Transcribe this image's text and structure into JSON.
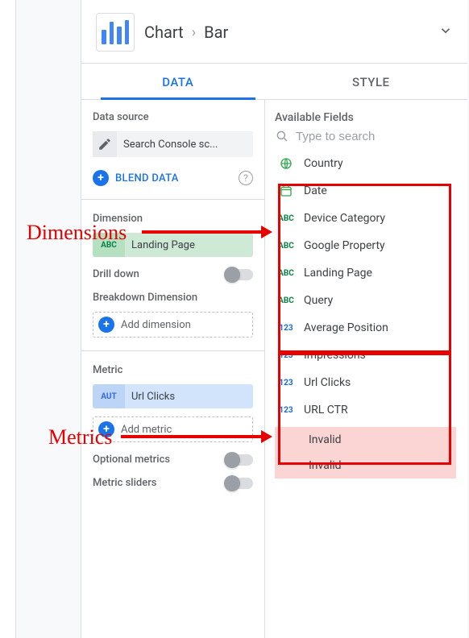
{
  "header": {
    "crumb_chart": "Chart",
    "crumb_type": "Bar"
  },
  "tabs": {
    "data": "DATA",
    "style": "STYLE"
  },
  "left": {
    "data_source_label": "Data source",
    "data_source_name": "Search Console sc...",
    "blend_label": "BLEND DATA",
    "dimension_label": "Dimension",
    "dimension_chip_tag": "ABC",
    "dimension_chip_text": "Landing Page",
    "drilldown_label": "Drill down",
    "breakdown_label": "Breakdown Dimension",
    "add_dimension": "Add dimension",
    "metric_label": "Metric",
    "metric_chip_tag": "AUT",
    "metric_chip_text": "Url Clicks",
    "add_metric": "Add metric",
    "optional_metrics_label": "Optional metrics",
    "metric_sliders_label": "Metric sliders"
  },
  "right": {
    "available_fields_label": "Available Fields",
    "search_placeholder": "Type to search",
    "fields_dim": [
      {
        "kind": "globe",
        "label": "Country"
      },
      {
        "kind": "calendar",
        "label": "Date"
      },
      {
        "kind": "abc",
        "label": "Device Category"
      },
      {
        "kind": "abc",
        "label": "Google Property"
      },
      {
        "kind": "abc",
        "label": "Landing Page"
      },
      {
        "kind": "abc",
        "label": "Query"
      }
    ],
    "fields_metric": [
      {
        "label": "Average Position"
      },
      {
        "label": "Impressions"
      },
      {
        "label": "Url Clicks"
      },
      {
        "label": "URL CTR"
      }
    ],
    "invalid": [
      "Invalid",
      "Invalid"
    ]
  },
  "annotations": {
    "dimensions": "Dimensions",
    "metrics": "Metrics"
  }
}
